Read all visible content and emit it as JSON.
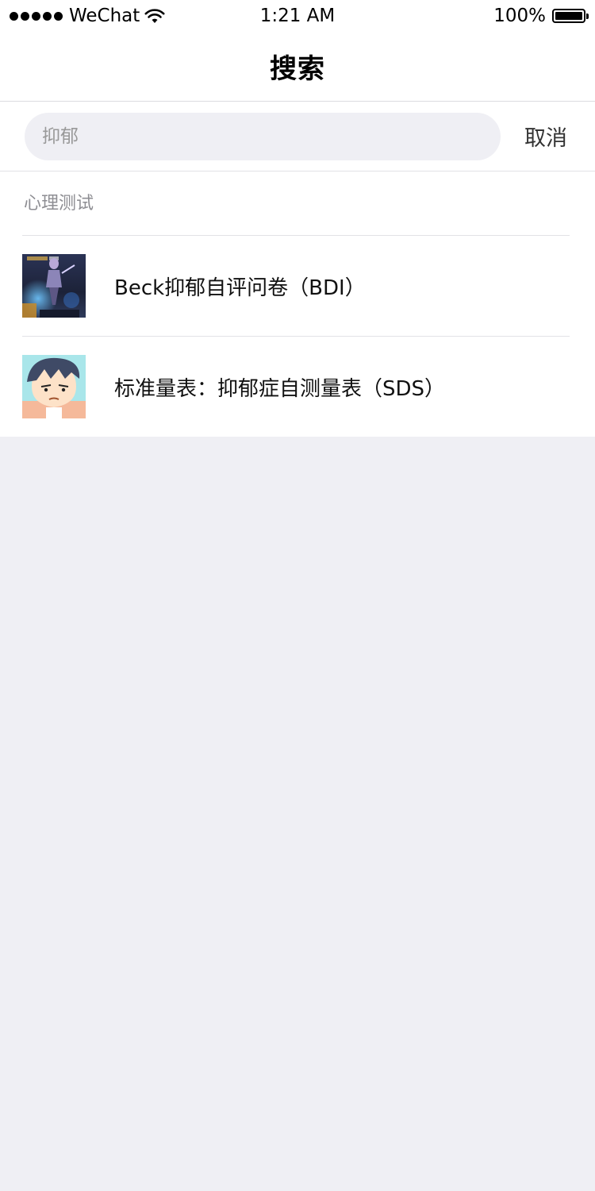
{
  "status_bar": {
    "carrier": "WeChat",
    "time": "1:21 AM",
    "battery": "100%"
  },
  "nav": {
    "title": "搜索"
  },
  "search": {
    "placeholder": "抑郁",
    "cancel_label": "取消"
  },
  "section": {
    "title": "心理测试"
  },
  "results": [
    {
      "title": "Beck抑郁自评问卷（BDI）",
      "thumbnail": "game-character-thumbnail"
    },
    {
      "title": "标准量表：抑郁症自测量表（SDS）",
      "thumbnail": "cartoon-boy-thumbnail"
    }
  ],
  "colors": {
    "background": "#efeff4",
    "search_field": "#efeff4",
    "divider": "#e2e2e6",
    "section_label": "#8e8e93"
  }
}
